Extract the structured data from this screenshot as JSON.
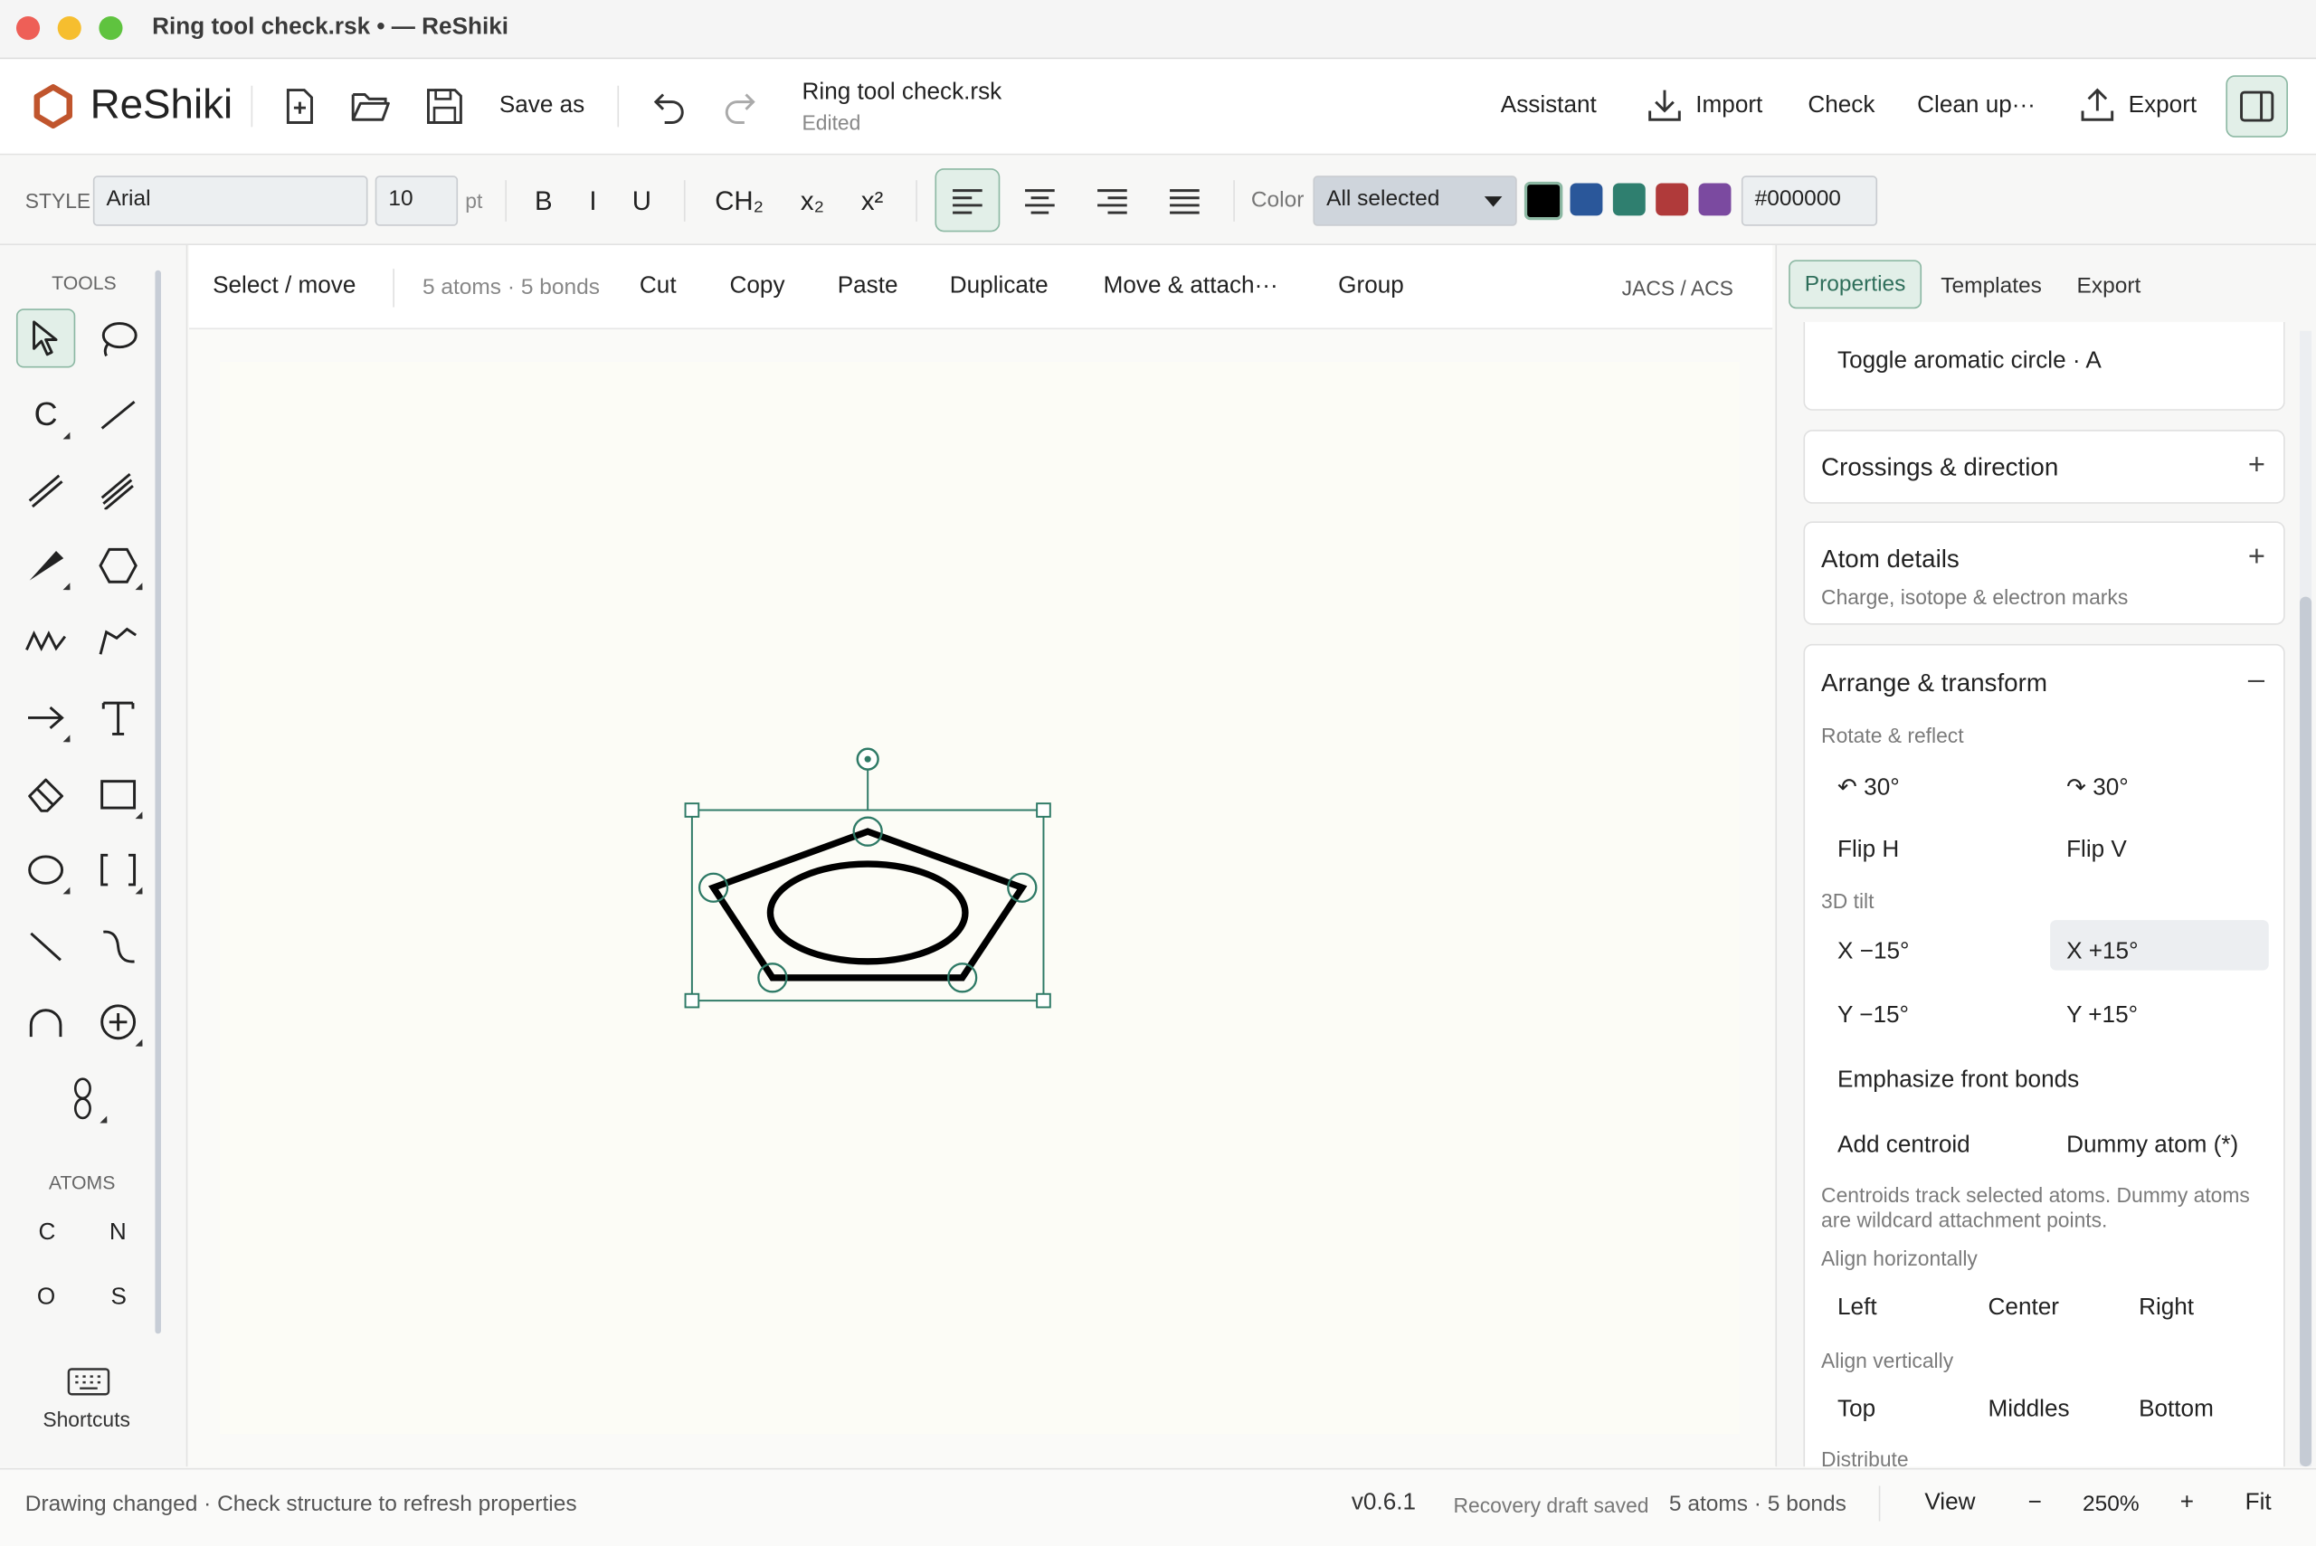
{
  "window": {
    "title": "Ring tool check.rsk • — ReShiki"
  },
  "app": {
    "name": "ReShiki"
  },
  "toolbar": {
    "save_as": "Save as",
    "doc_name": "Ring tool check.rsk",
    "doc_status": "Edited",
    "assistant": "Assistant",
    "import": "Import",
    "check": "Check",
    "clean_up": "Clean up···",
    "export": "Export"
  },
  "format": {
    "style_label": "STYLE",
    "font": "Arial",
    "size": "10",
    "size_unit": "pt",
    "bold": "B",
    "italic": "I",
    "underline": "U",
    "formula": "CH₂",
    "subscript": "x₂",
    "superscript": "x²",
    "color_label": "Color",
    "color_scope": "All selected",
    "hex": "#000000",
    "swatches": [
      "#000000",
      "#2a579a",
      "#2f7f6f",
      "#b03a3a",
      "#7b4aa0"
    ]
  },
  "tools": {
    "header": "TOOLS",
    "atoms_header": "ATOMS",
    "atoms": [
      "C",
      "N",
      "O",
      "S"
    ],
    "shortcuts": "Shortcuts"
  },
  "edit": {
    "mode": "Select / move",
    "count": "5 atoms · 5 bonds",
    "cut": "Cut",
    "copy": "Copy",
    "paste": "Paste",
    "duplicate": "Duplicate",
    "move_attach": "Move & attach···",
    "group": "Group",
    "standard": "JACS / ACS"
  },
  "panel": {
    "tabs": [
      "Properties",
      "Templates",
      "Export"
    ],
    "toggle_aromatic": "Toggle aromatic circle · A",
    "crossings": "Crossings & direction",
    "atom_details": "Atom details",
    "atom_details_sub": "Charge, isotope & electron marks",
    "arrange": "Arrange & transform",
    "rotate_reflect": "Rotate & reflect",
    "rot_ccw": "↶ 30°",
    "rot_cw": "↷ 30°",
    "flip_h": "Flip H",
    "flip_v": "Flip V",
    "tilt": "3D tilt",
    "x_minus": "X −15°",
    "x_plus": "X +15°",
    "y_minus": "Y −15°",
    "y_plus": "Y +15°",
    "emphasize": "Emphasize front bonds",
    "add_centroid": "Add centroid",
    "dummy_atom": "Dummy atom (*)",
    "centroid_note": "Centroids track selected atoms. Dummy atoms are wildcard attachment points.",
    "align_h": "Align horizontally",
    "left": "Left",
    "center": "Center",
    "right": "Right",
    "align_v": "Align vertically",
    "top": "Top",
    "middles": "Middles",
    "bottom": "Bottom",
    "distribute": "Distribute"
  },
  "status": {
    "message": "Drawing changed · Check structure to refresh properties",
    "version": "v0.6.1",
    "recovery": "Recovery draft saved",
    "count": "5 atoms · 5 bonds",
    "view": "View",
    "zoom_out": "−",
    "zoom": "250%",
    "zoom_in": "+",
    "fit": "Fit"
  }
}
